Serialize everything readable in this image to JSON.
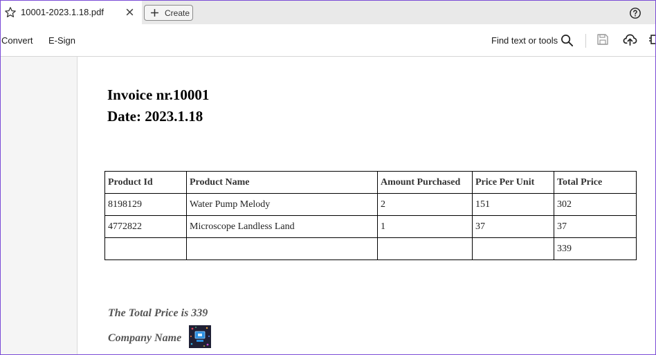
{
  "tab": {
    "title": "10001-2023.1.18.pdf",
    "create_label": "Create"
  },
  "toolbar": {
    "menu": [
      "Convert",
      "E-Sign"
    ],
    "find_label": "Find text or tools"
  },
  "document": {
    "heading_invoice": "Invoice nr.10001",
    "heading_date": "Date: 2023.1.18",
    "table": {
      "headers": [
        "Product Id",
        "Product Name",
        "Amount Purchased",
        "Price Per Unit",
        "Total Price"
      ],
      "rows": [
        [
          "8198129",
          "Water Pump Melody",
          "2",
          "151",
          "302"
        ],
        [
          "4772822",
          "Microscope Landless Land",
          "1",
          "37",
          "37"
        ],
        [
          "",
          "",
          "",
          "",
          "339"
        ]
      ]
    },
    "total_text": "The Total Price is 339",
    "company_text": "Company Name"
  },
  "colors": {
    "accent_border": "#7a4bd6",
    "tabbar_bg": "#e9e9e9"
  },
  "icons": [
    "star-icon",
    "close-icon",
    "plus-icon",
    "help-icon",
    "search-icon",
    "save-icon",
    "cloud-upload-icon",
    "more-tools-icon",
    "company-logo"
  ]
}
